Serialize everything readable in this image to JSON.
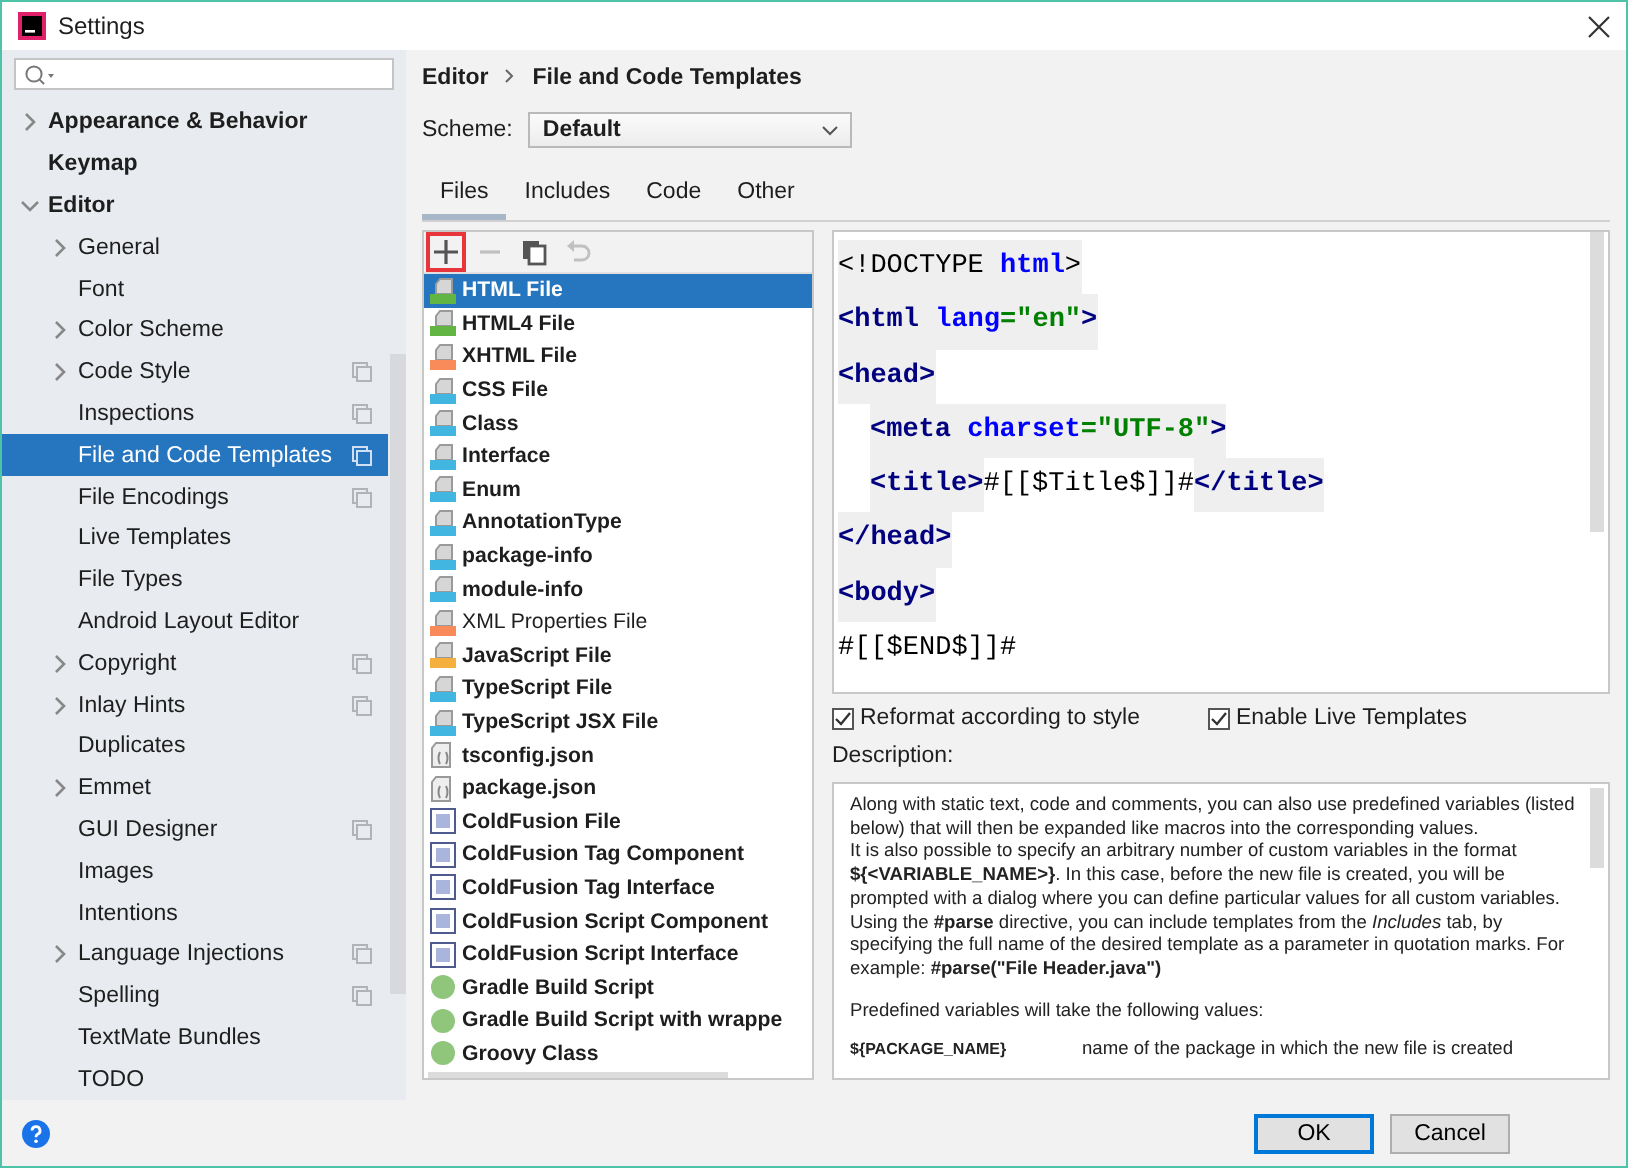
{
  "window": {
    "title": "Settings"
  },
  "sidebar": {
    "items": [
      {
        "label": "Appearance & Behavior",
        "bold": true,
        "expanded": false,
        "scoped": false,
        "selected": false
      },
      {
        "label": "Keymap",
        "bold": true,
        "scoped": false,
        "selected": false
      },
      {
        "label": "Editor",
        "bold": true,
        "expanded": true,
        "scoped": false,
        "selected": false,
        "children": [
          {
            "label": "General",
            "bold": false,
            "expanded": false,
            "scoped": false,
            "selected": false
          },
          {
            "label": "Font",
            "bold": false,
            "scoped": false,
            "selected": false
          },
          {
            "label": "Color Scheme",
            "bold": false,
            "expanded": false,
            "scoped": false,
            "selected": false
          },
          {
            "label": "Code Style",
            "bold": false,
            "expanded": false,
            "scoped": true,
            "selected": false
          },
          {
            "label": "Inspections",
            "bold": false,
            "scoped": true,
            "selected": false
          },
          {
            "label": "File and Code Templates",
            "bold": false,
            "scoped": true,
            "selected": true
          },
          {
            "label": "File Encodings",
            "bold": false,
            "scoped": true,
            "selected": false
          },
          {
            "label": "Live Templates",
            "bold": false,
            "scoped": false,
            "selected": false
          },
          {
            "label": "File Types",
            "bold": false,
            "scoped": false,
            "selected": false
          },
          {
            "label": "Android Layout Editor",
            "bold": false,
            "scoped": false,
            "selected": false
          },
          {
            "label": "Copyright",
            "bold": false,
            "expanded": false,
            "scoped": true,
            "selected": false
          },
          {
            "label": "Inlay Hints",
            "bold": false,
            "expanded": false,
            "scoped": true,
            "selected": false
          },
          {
            "label": "Duplicates",
            "bold": false,
            "scoped": false,
            "selected": false
          },
          {
            "label": "Emmet",
            "bold": false,
            "expanded": false,
            "scoped": false,
            "selected": false
          },
          {
            "label": "GUI Designer",
            "bold": false,
            "scoped": true,
            "selected": false
          },
          {
            "label": "Images",
            "bold": false,
            "scoped": false,
            "selected": false
          },
          {
            "label": "Intentions",
            "bold": false,
            "scoped": false,
            "selected": false
          },
          {
            "label": "Language Injections",
            "bold": false,
            "expanded": false,
            "scoped": true,
            "selected": false
          },
          {
            "label": "Spelling",
            "bold": false,
            "scoped": true,
            "selected": false
          },
          {
            "label": "TextMate Bundles",
            "bold": false,
            "scoped": false,
            "selected": false
          },
          {
            "label": "TODO",
            "bold": false,
            "scoped": false,
            "selected": false
          }
        ]
      }
    ]
  },
  "breadcrumb": [
    "Editor",
    "File and Code Templates"
  ],
  "scheme": {
    "label": "Scheme:",
    "value": "Default"
  },
  "tabs": [
    {
      "label": "Files",
      "selected": true
    },
    {
      "label": "Includes",
      "selected": false
    },
    {
      "label": "Code",
      "selected": false
    },
    {
      "label": "Other",
      "selected": false
    }
  ],
  "toolbar": [
    {
      "kind": "add",
      "disabled": false,
      "highlighted": true
    },
    {
      "kind": "remove",
      "disabled": true,
      "highlighted": false
    },
    {
      "kind": "copy",
      "disabled": false,
      "highlighted": false
    },
    {
      "kind": "reset",
      "disabled": true,
      "highlighted": false
    }
  ],
  "templates": [
    {
      "name": "HTML File",
      "kind": "html",
      "bold": true,
      "selected": true
    },
    {
      "name": "HTML4 File",
      "kind": "html",
      "bold": true,
      "selected": false
    },
    {
      "name": "XHTML File",
      "kind": "xhtml",
      "bold": true,
      "selected": false
    },
    {
      "name": "CSS File",
      "kind": "css",
      "bold": true,
      "selected": false
    },
    {
      "name": "Class",
      "kind": "java",
      "bold": true,
      "selected": false
    },
    {
      "name": "Interface",
      "kind": "java",
      "bold": true,
      "selected": false
    },
    {
      "name": "Enum",
      "kind": "java",
      "bold": true,
      "selected": false
    },
    {
      "name": "AnnotationType",
      "kind": "java",
      "bold": true,
      "selected": false
    },
    {
      "name": "package-info",
      "kind": "java",
      "bold": true,
      "selected": false
    },
    {
      "name": "module-info",
      "kind": "java",
      "bold": true,
      "selected": false
    },
    {
      "name": "XML Properties File",
      "kind": "xml",
      "bold": false,
      "selected": false
    },
    {
      "name": "JavaScript File",
      "kind": "js",
      "bold": true,
      "selected": false
    },
    {
      "name": "TypeScript File",
      "kind": "ts",
      "bold": true,
      "selected": false
    },
    {
      "name": "TypeScript JSX File",
      "kind": "ts",
      "bold": true,
      "selected": false
    },
    {
      "name": "tsconfig.json",
      "kind": "json",
      "bold": true,
      "selected": false
    },
    {
      "name": "package.json",
      "kind": "json",
      "bold": true,
      "selected": false
    },
    {
      "name": "ColdFusion File",
      "kind": "cf",
      "bold": true,
      "selected": false
    },
    {
      "name": "ColdFusion Tag Component",
      "kind": "cf",
      "bold": true,
      "selected": false
    },
    {
      "name": "ColdFusion Tag Interface",
      "kind": "cf",
      "bold": true,
      "selected": false
    },
    {
      "name": "ColdFusion Script Component",
      "kind": "cf",
      "bold": true,
      "selected": false
    },
    {
      "name": "ColdFusion Script Interface",
      "kind": "cf",
      "bold": true,
      "selected": false
    },
    {
      "name": "Gradle Build Script",
      "kind": "gradle",
      "bold": true,
      "selected": false
    },
    {
      "name": "Gradle Build Script with wrappe",
      "kind": "gradle",
      "bold": true,
      "selected": false
    },
    {
      "name": "Groovy Class",
      "kind": "gradle",
      "bold": true,
      "selected": false
    }
  ],
  "editor": {
    "lines": [
      {
        "indented": false,
        "tokens": [
          {
            "kind": "markup",
            "text": "<!DOCTYPE "
          },
          {
            "kind": "attr",
            "text": "html"
          },
          {
            "kind": "markup",
            "text": ">"
          }
        ]
      },
      {
        "indented": false,
        "tokens": [
          {
            "kind": "tag",
            "text": "<html "
          },
          {
            "kind": "attr",
            "text": "lang"
          },
          {
            "kind": "value",
            "text": "=\"en\""
          },
          {
            "kind": "tag",
            "text": ">"
          }
        ]
      },
      {
        "indented": false,
        "tokens": [
          {
            "kind": "tag",
            "text": "<head>"
          }
        ]
      },
      {
        "indented": true,
        "tokens": [
          {
            "kind": "tag",
            "text": "<meta "
          },
          {
            "kind": "attr",
            "text": "charset"
          },
          {
            "kind": "value",
            "text": "=\"UTF-8\""
          },
          {
            "kind": "tag",
            "text": ">"
          }
        ]
      },
      {
        "indented": true,
        "tokens": [
          {
            "kind": "tag",
            "text": "<title>"
          },
          {
            "kind": "text",
            "text": "#[[$Title$]]#"
          },
          {
            "kind": "tag",
            "text": "</title>"
          }
        ]
      },
      {
        "indented": false,
        "tokens": [
          {
            "kind": "tag",
            "text": "</head>"
          }
        ]
      },
      {
        "indented": false,
        "tokens": [
          {
            "kind": "tag",
            "text": "<body>"
          }
        ]
      },
      {
        "indented": false,
        "tokens": [
          {
            "kind": "text",
            "text": "#[[$END$]]#"
          }
        ]
      }
    ]
  },
  "options": [
    {
      "label": "Reformat according to style",
      "checked": true
    },
    {
      "label": "Enable Live Templates",
      "checked": true
    }
  ],
  "description": {
    "label": "Description:",
    "paragraphs": [
      "Along with static text, code and comments, you can also use predefined variables (listed below) that will then be expanded like macros into the corresponding values.",
      "It is also possible to specify an arbitrary number of custom variables in the format **${<VARIABLE_NAME>}**. In this case, before the new file is created, you will be prompted with a dialog where you can define particular values for all custom variables.",
      "Using the **#parse** directive, you can include templates from the *Includes* tab, by specifying the full name of the desired template as a parameter in quotation marks. For example: **#parse(\"File Header.java\")**",
      "Predefined variables will take the following values:"
    ],
    "variables": [
      {
        "name": "${PACKAGE_NAME}",
        "meaning": "name of the package in which the new file is created"
      }
    ]
  },
  "buttons": [
    {
      "label": "OK",
      "default": true
    },
    {
      "label": "Cancel",
      "default": false
    }
  ]
}
